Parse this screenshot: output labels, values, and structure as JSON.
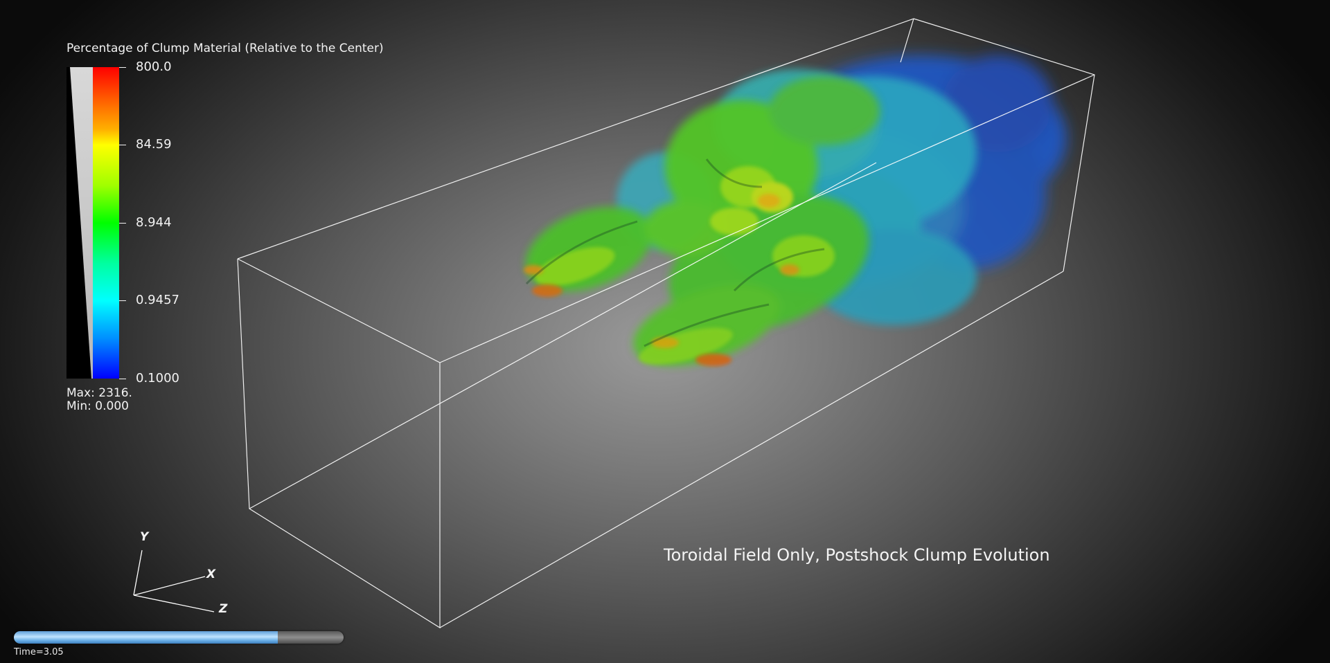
{
  "legend": {
    "title": "Percentage of Clump Material (Relative to the Center)",
    "ticks": [
      "800.0",
      "84.59",
      "8.944",
      "0.9457",
      "0.1000"
    ],
    "max_label": "Max:  2316.",
    "min_label": "Min:  0.000"
  },
  "caption": "Toroidal Field Only, Postshock Clump Evolution",
  "axes": {
    "x": "X",
    "y": "Y",
    "z": "Z"
  },
  "time": {
    "label": "Time=3.05",
    "progress": 0.8
  },
  "colors": {
    "bounding_box": "#ffffff",
    "clump_high": "#ff3000",
    "clump_mid": "#2ec81e",
    "clump_low": "#1a4fd8"
  }
}
